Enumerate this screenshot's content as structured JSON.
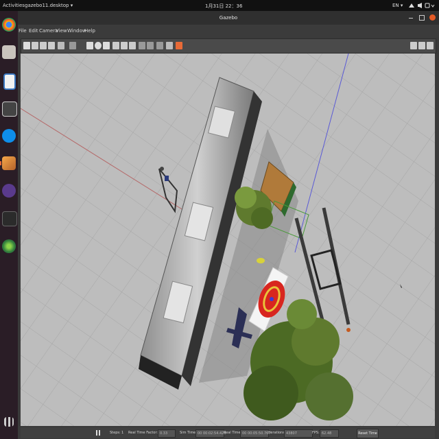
{
  "topbar": {
    "activities": "Activities",
    "app_menu": "gazebo11.desktop ▾",
    "clock": "1月31日 22：36",
    "lang": "EN ▾"
  },
  "window": {
    "title": "Gazebo"
  },
  "menu": {
    "file": "File",
    "edit": "Edit",
    "camera": "Camera",
    "view": "View",
    "window": "Window",
    "help": "Help"
  },
  "bottom": {
    "steps_label": "Steps:",
    "steps_value": "1",
    "rtf_label": "Real Time Factor:",
    "rtf_value": "0.33",
    "sim_time_label": "Sim Time:",
    "sim_time_value": "00 00:02:54.428",
    "real_time_label": "Real Time:",
    "real_time_value": "00 00:05:50.767",
    "iterations_label": "Iterations:",
    "iterations_value": "43807",
    "fps_label": "FPS:",
    "fps_value": "62.48",
    "reset_label": "Reset Time"
  },
  "colors": {
    "accent": "#e86a37",
    "grid": "#b8b8b8"
  },
  "icons": [
    "chrome-icon",
    "files-icon",
    "document-icon",
    "terminal-square-icon",
    "teamviewer-icon",
    "box-app-icon",
    "qv-icon",
    "terminal-icon",
    "browser-icon"
  ]
}
